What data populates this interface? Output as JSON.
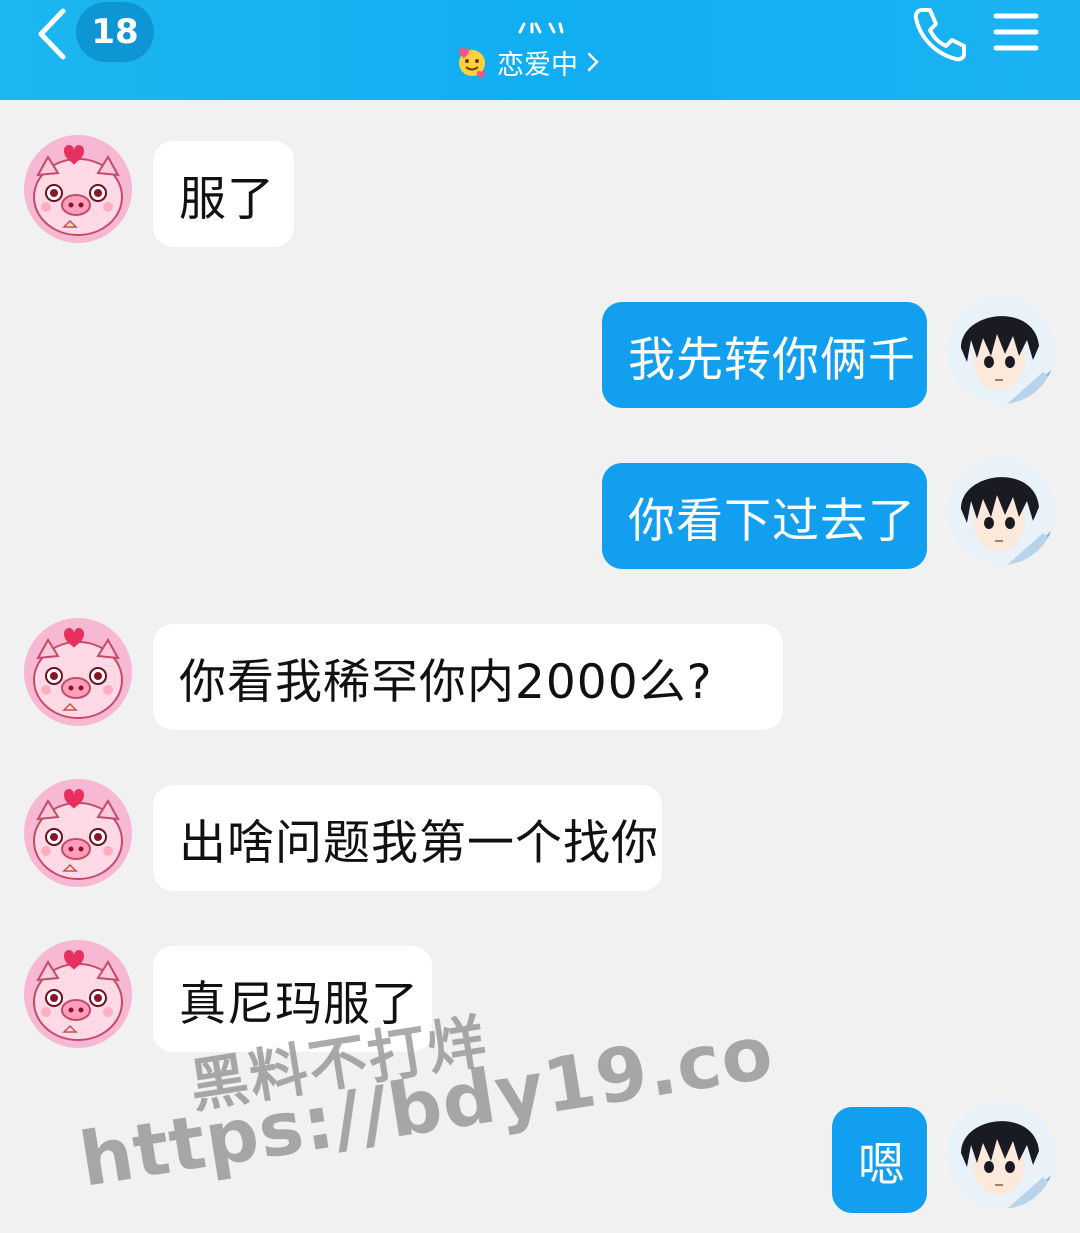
{
  "header": {
    "unread_count": "18",
    "contact_status": "恋爱中",
    "back_icon": "chevron-left-icon",
    "call_icon": "phone-icon",
    "menu_icon": "menu-icon",
    "accent": "#13aef2"
  },
  "messages": [
    {
      "side": "in",
      "text": "服了"
    },
    {
      "side": "out",
      "text": "我先转你俩千"
    },
    {
      "side": "out",
      "text": "你看下过去了"
    },
    {
      "side": "in",
      "text": "你看我稀罕你内2000么?"
    },
    {
      "side": "in",
      "text": "出啥问题我第一个找你"
    },
    {
      "side": "in",
      "text": "真尼玛服了"
    },
    {
      "side": "out",
      "text": "嗯"
    }
  ],
  "watermark": {
    "line1": "黑料不打烊",
    "line2": "https://bdy19.co"
  }
}
